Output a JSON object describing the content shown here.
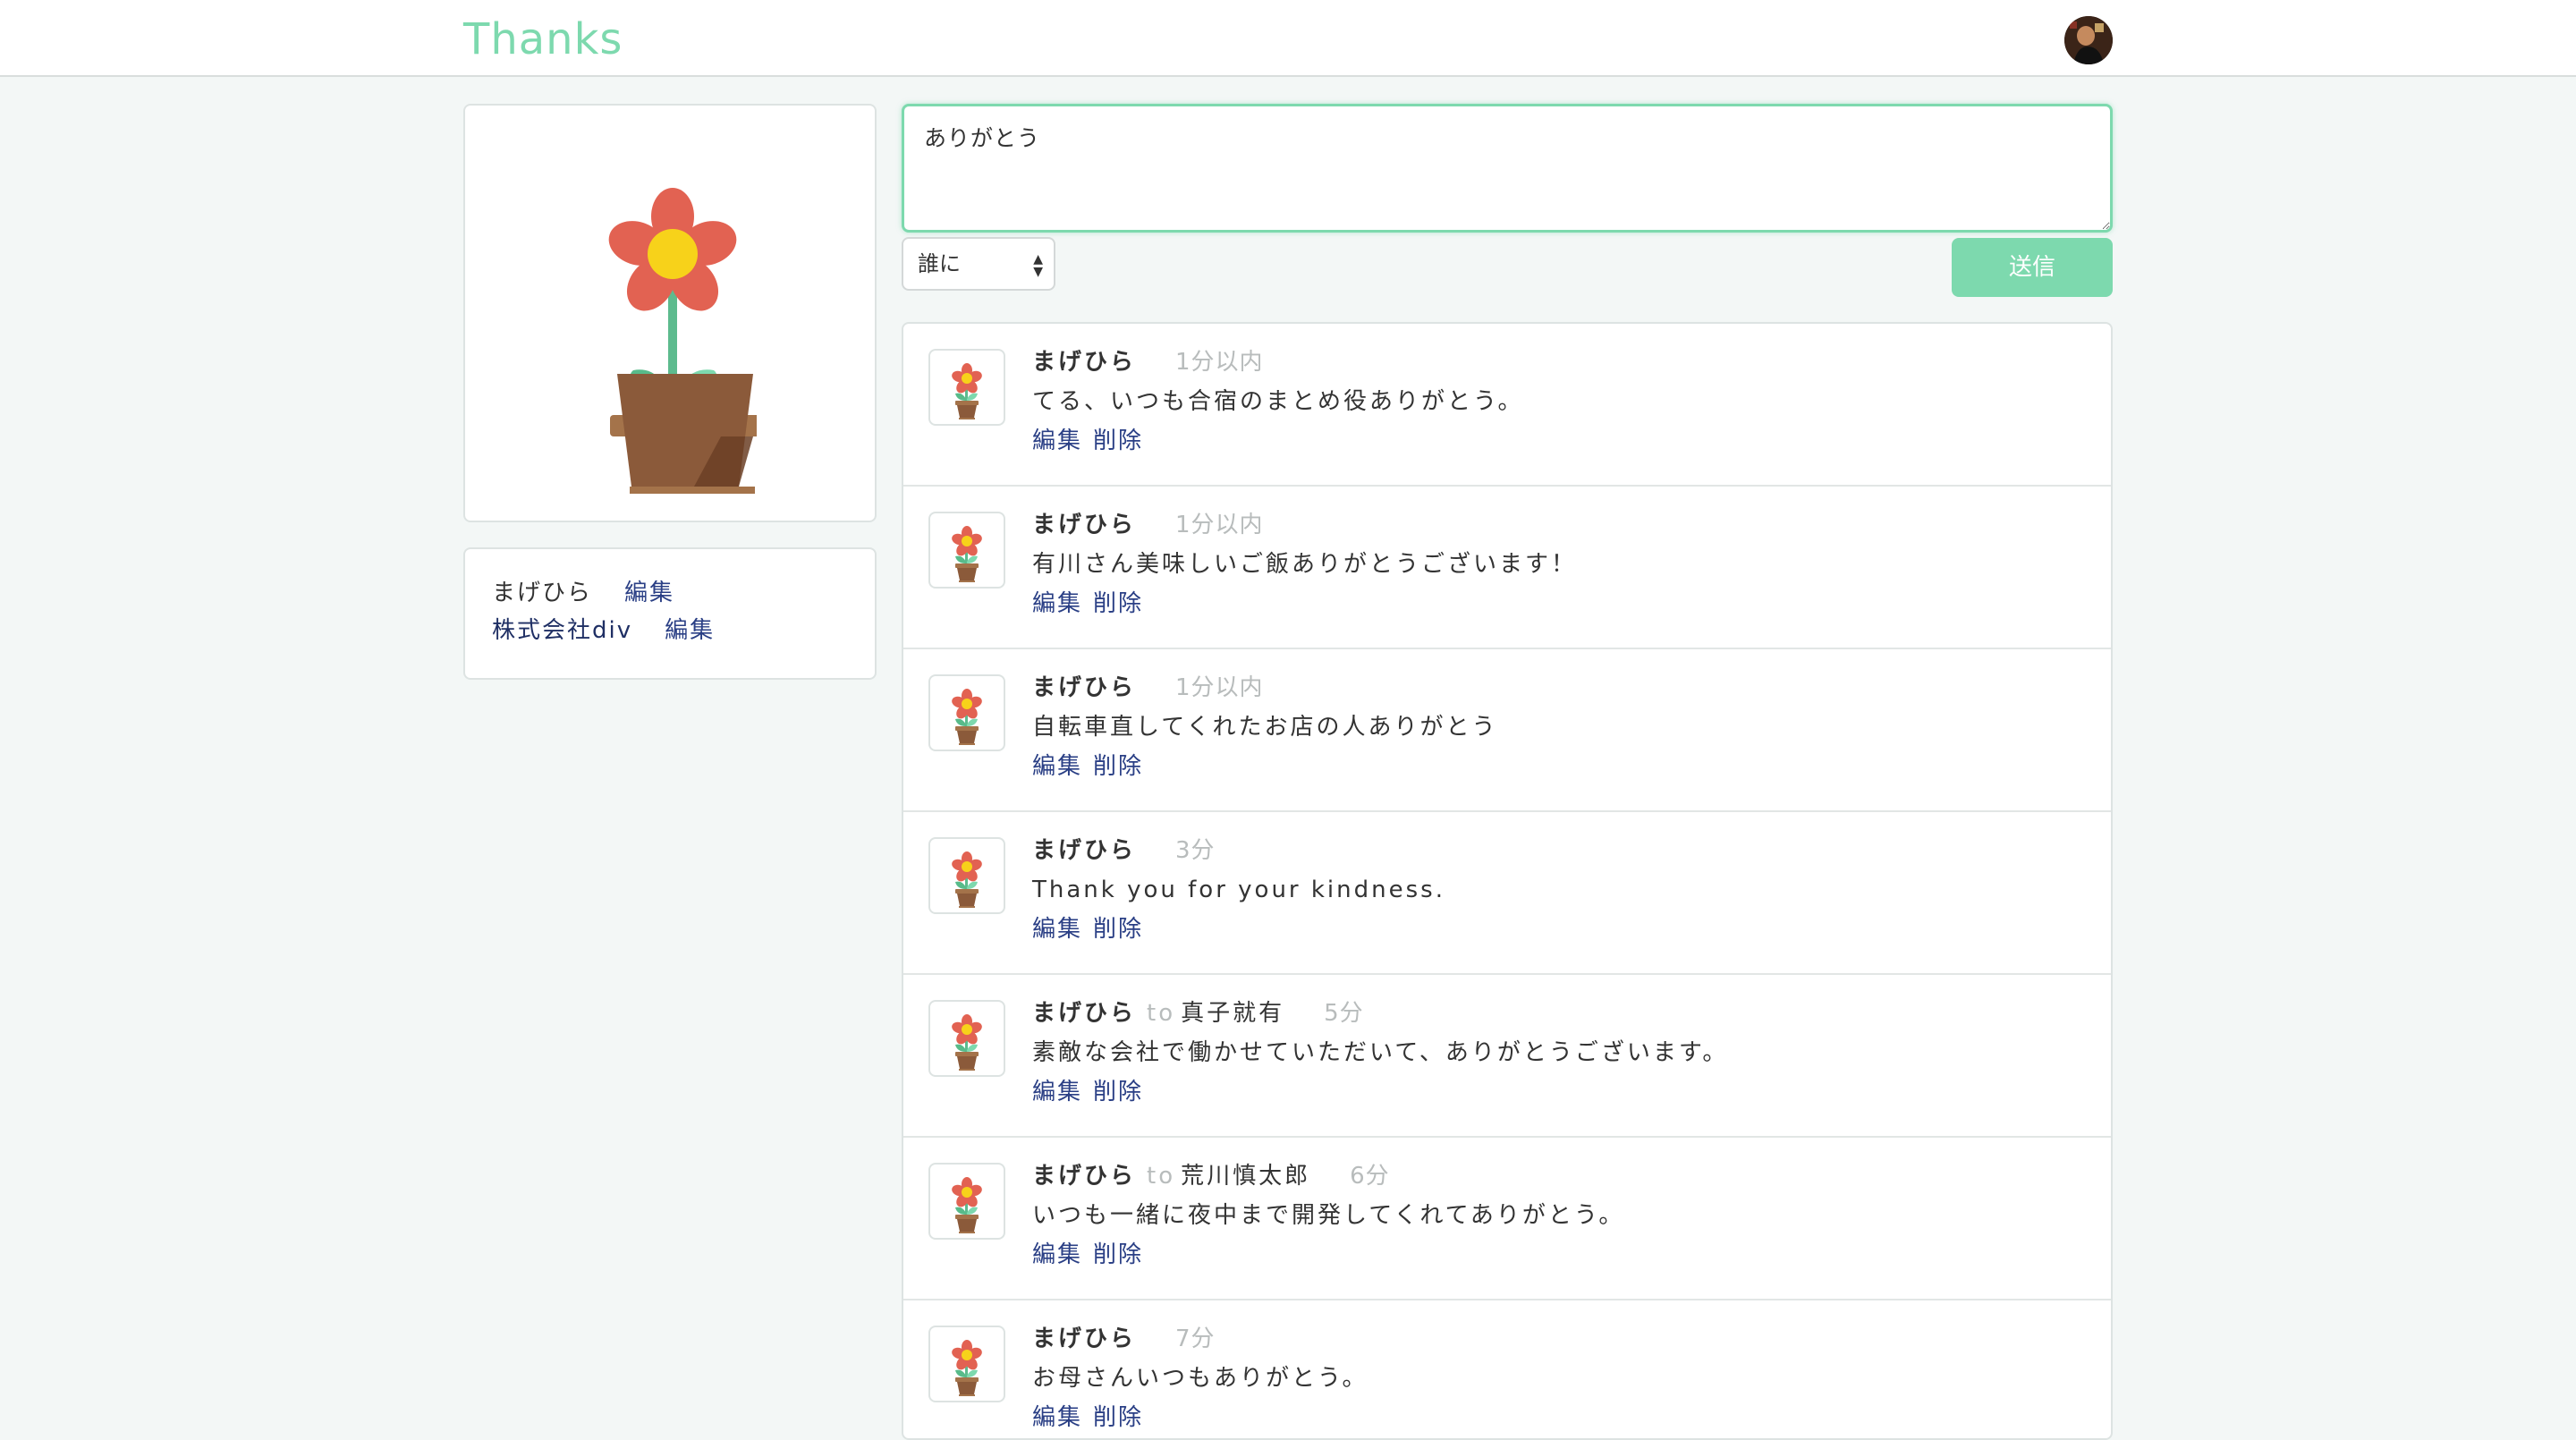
{
  "header": {
    "brand": "Thanks",
    "avatar_icon": "user-avatar"
  },
  "colors": {
    "accent": "#7dd9ae",
    "link": "#2a3f85",
    "muted": "#b8bcbc",
    "background": "#f3f7f6"
  },
  "profile": {
    "image_icon": "flower-pot-icon",
    "name": "まげひら",
    "name_edit_label": "編集",
    "company": "株式会社div",
    "company_edit_label": "編集"
  },
  "compose": {
    "message_value": "ありがとう",
    "recipient_select_value": "誰に",
    "send_label": "送信"
  },
  "feed": {
    "to_label": "to",
    "edit_label": "編集",
    "delete_label": "削除",
    "posts": [
      {
        "author": "まげひら",
        "recipient": "",
        "time": "1分以内",
        "message": "てる、いつも合宿のまとめ役ありがとう。"
      },
      {
        "author": "まげひら",
        "recipient": "",
        "time": "1分以内",
        "message": "有川さん美味しいご飯ありがとうございます！"
      },
      {
        "author": "まげひら",
        "recipient": "",
        "time": "1分以内",
        "message": "自転車直してくれたお店の人ありがとう"
      },
      {
        "author": "まげひら",
        "recipient": "",
        "time": "3分",
        "message": "Thank you for your kindness."
      },
      {
        "author": "まげひら",
        "recipient": "真子就有",
        "time": "5分",
        "message": "素敵な会社で働かせていただいて、ありがとうございます。"
      },
      {
        "author": "まげひら",
        "recipient": "荒川慎太郎",
        "time": "6分",
        "message": "いつも一緒に夜中まで開発してくれてありがとう。"
      },
      {
        "author": "まげひら",
        "recipient": "",
        "time": "7分",
        "message": "お母さんいつもありがとう。"
      }
    ]
  }
}
